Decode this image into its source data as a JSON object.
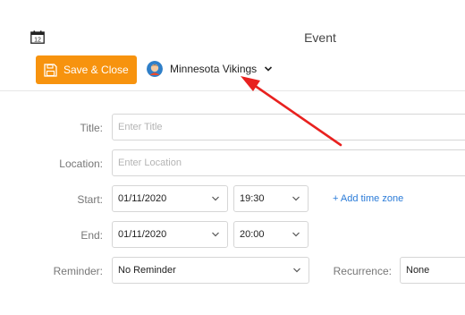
{
  "window": {
    "title": "Event"
  },
  "toolbar": {
    "save_label": "Save & Close",
    "account_name": "Minnesota Vikings"
  },
  "form": {
    "title": {
      "label": "Title:",
      "placeholder": "Enter Title"
    },
    "location": {
      "label": "Location:",
      "placeholder": "Enter Location"
    },
    "start": {
      "label": "Start:",
      "date": "01/11/2020",
      "time": "19:30",
      "add_timezone": "+ Add time zone"
    },
    "end": {
      "label": "End:",
      "date": "01/11/2020",
      "time": "20:00"
    },
    "reminder": {
      "label": "Reminder:",
      "value": "No Reminder"
    },
    "recurrence": {
      "label": "Recurrence:",
      "value": "None"
    }
  },
  "annotation": {
    "arrow_color": "#e8211f"
  },
  "colors": {
    "accent": "#f7930e",
    "link": "#2a7bd8"
  }
}
